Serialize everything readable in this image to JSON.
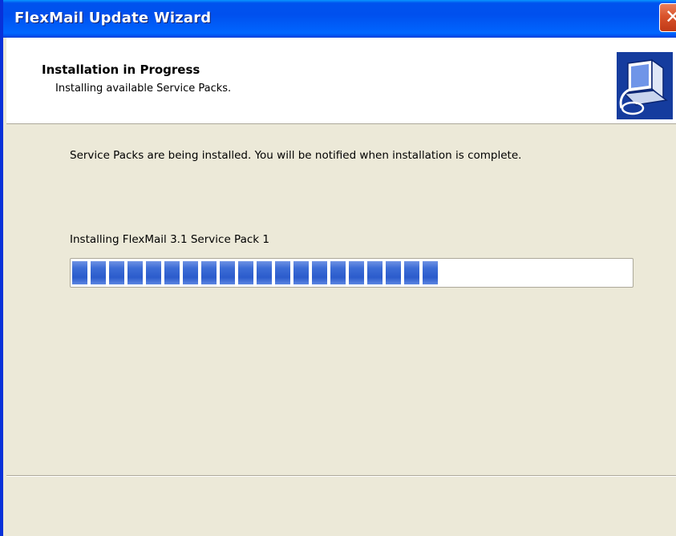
{
  "window": {
    "title": "FlexMail Update Wizard",
    "close_glyph": "✕",
    "colors": {
      "titlebar": "#0053ee",
      "frame": "#0831d9",
      "body": "#ece9d8",
      "close": "#d9532b",
      "progress": "#2b5ccc"
    }
  },
  "header": {
    "title": "Installation in Progress",
    "subtitle": "Installing available Service Packs.",
    "icon": "computer-install-icon"
  },
  "main": {
    "message": "Service Packs are being installed. You will be notified when installation is complete.",
    "progress": {
      "label": "Installing FlexMail 3.1 Service Pack 1",
      "fraction": 0.68
    }
  }
}
